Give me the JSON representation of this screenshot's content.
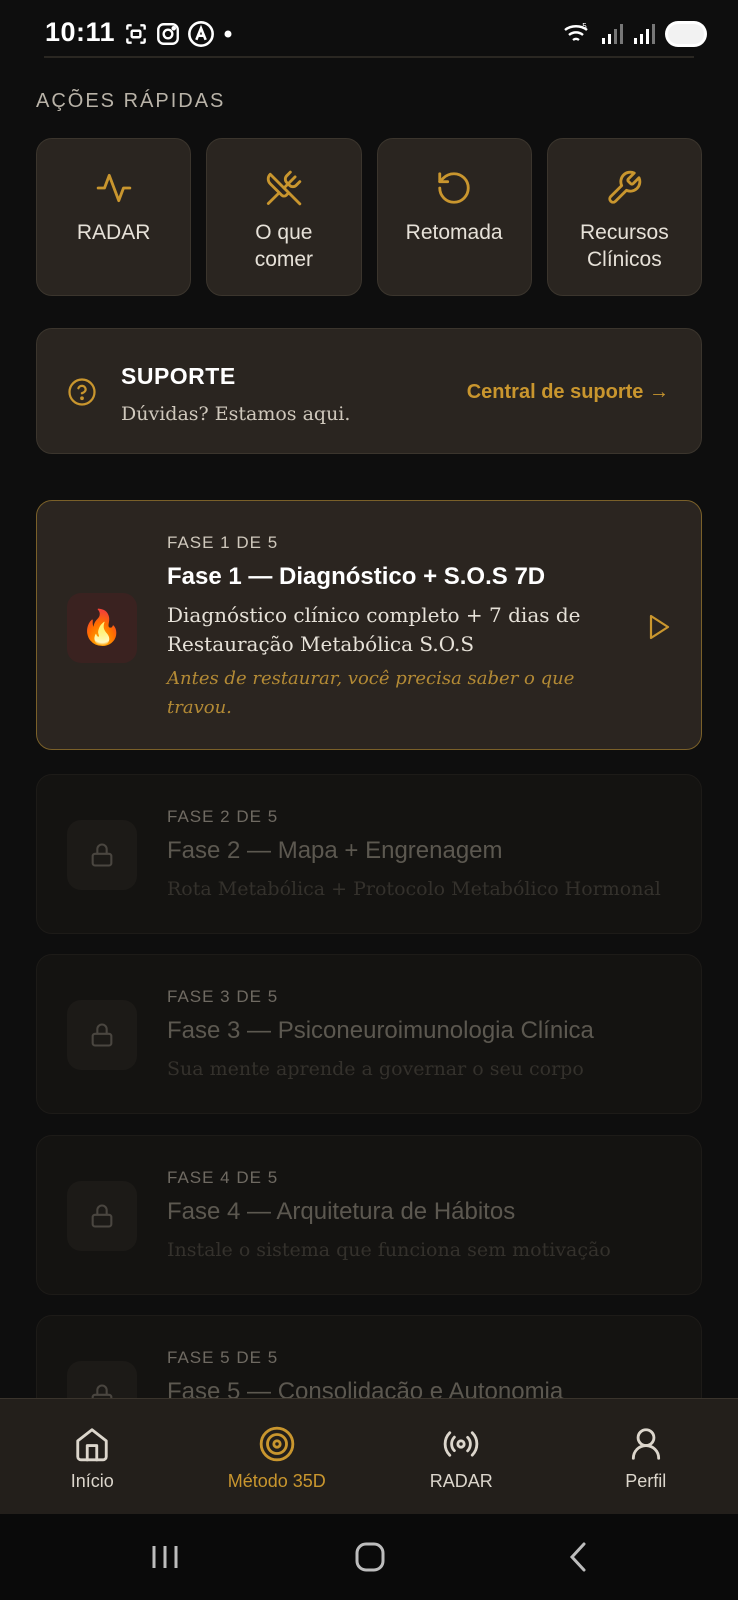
{
  "status_bar": {
    "time": "10:11",
    "left_icons": [
      "screenshot-icon",
      "instagram-icon",
      "app-a-icon",
      "dot-icon"
    ],
    "right_icons": [
      "wifi-icon",
      "signal-icon",
      "signal-icon",
      "battery-icon"
    ]
  },
  "quick_actions": {
    "heading": "AÇÕES RÁPIDAS",
    "items": [
      {
        "label": "RADAR",
        "icon": "activity-icon"
      },
      {
        "label": "O que\ncomer",
        "icon": "utensils-crossed-icon"
      },
      {
        "label": "Retomada",
        "icon": "rotate-ccw-icon"
      },
      {
        "label": "Recursos\nClínicos",
        "icon": "wrench-icon"
      }
    ]
  },
  "support": {
    "title": "SUPORTE",
    "subtitle": "Dúvidas? Estamos aqui.",
    "link": "Central de suporte →",
    "icon": "help-circle-icon"
  },
  "phases": [
    {
      "kicker": "FASE 1 DE 5",
      "title": "Fase 1 — Diagnóstico + S.O.S 7D",
      "description": "Diagnóstico clínico completo + 7 dias de Restauração Metabólica S.O.S",
      "note": "Antes de restaurar, você precisa saber o que travou.",
      "icon": "🔥",
      "state": "active"
    },
    {
      "kicker": "FASE 2 DE 5",
      "title": "Fase 2 — Mapa + Engrenagem",
      "description": "Rota Metabólica + Protocolo Metabólico Hormonal",
      "state": "locked"
    },
    {
      "kicker": "FASE 3 DE 5",
      "title": "Fase 3 — Psiconeuroimunologia Clínica",
      "description": "Sua mente aprende a governar o seu corpo",
      "state": "locked"
    },
    {
      "kicker": "FASE 4 DE 5",
      "title": "Fase 4 — Arquitetura de Hábitos",
      "description": "Instale o sistema que funciona sem motivação",
      "state": "locked"
    },
    {
      "kicker": "FASE 5 DE 5",
      "title": "Fase 5 — Consolidação e Autonomia",
      "description": "",
      "state": "locked"
    }
  ],
  "bottom_nav": {
    "items": [
      {
        "label": "Início",
        "icon": "home-icon"
      },
      {
        "label": "Método 35D",
        "icon": "target-icon",
        "active": true
      },
      {
        "label": "RADAR",
        "icon": "radio-icon"
      },
      {
        "label": "Perfil",
        "icon": "user-icon"
      }
    ]
  },
  "colors": {
    "background": "#0e0e0e",
    "card": "#2a2520",
    "accent": "#c9962e",
    "active_border": "#7a6029"
  }
}
